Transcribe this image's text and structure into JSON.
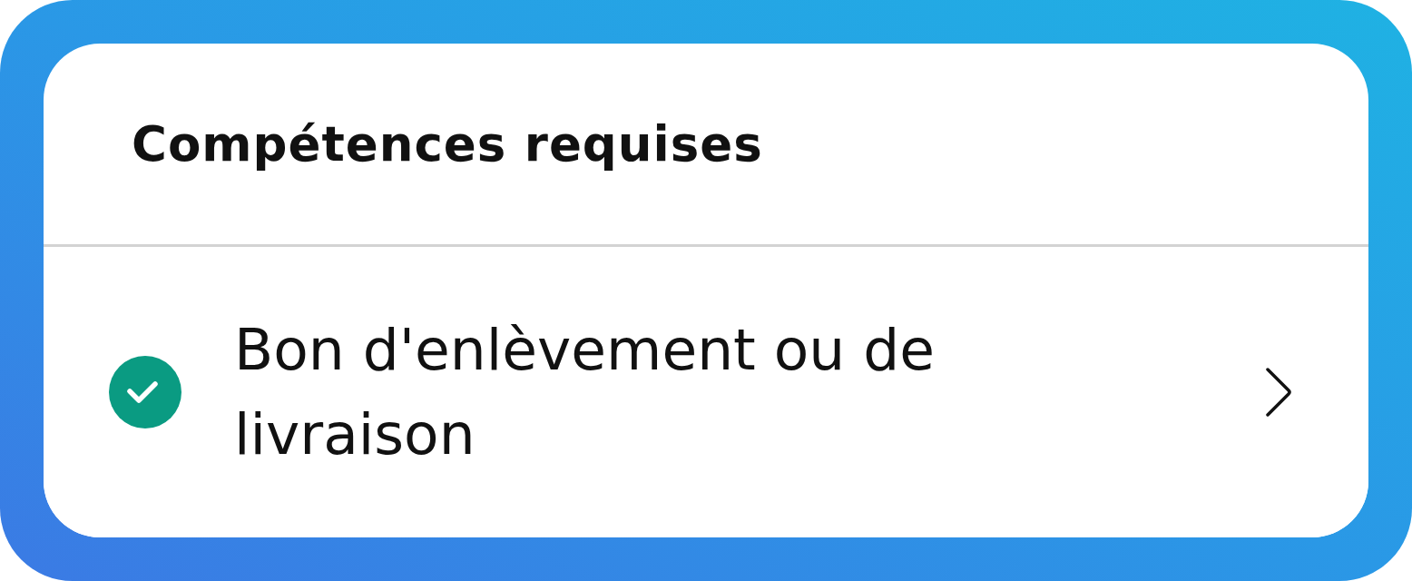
{
  "card": {
    "title": "Compétences requises",
    "items": [
      {
        "label": "Bon d'enlèvement ou de livraison",
        "checked": true
      }
    ]
  }
}
